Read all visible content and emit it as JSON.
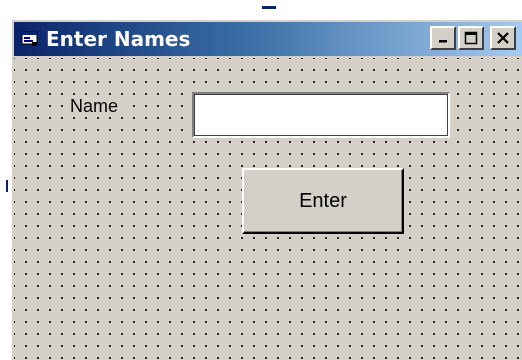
{
  "window": {
    "title": "Enter Names",
    "icon": "form-icon",
    "caption_buttons": [
      "minimize-icon",
      "maximize-icon",
      "close-icon"
    ]
  },
  "form": {
    "name_label": "Name",
    "name_input_value": "",
    "enter_button_label": "Enter"
  },
  "colors": {
    "titlebar_start": "#0a246a",
    "titlebar_end": "#a6caf0",
    "face": "#d4d0c8"
  }
}
